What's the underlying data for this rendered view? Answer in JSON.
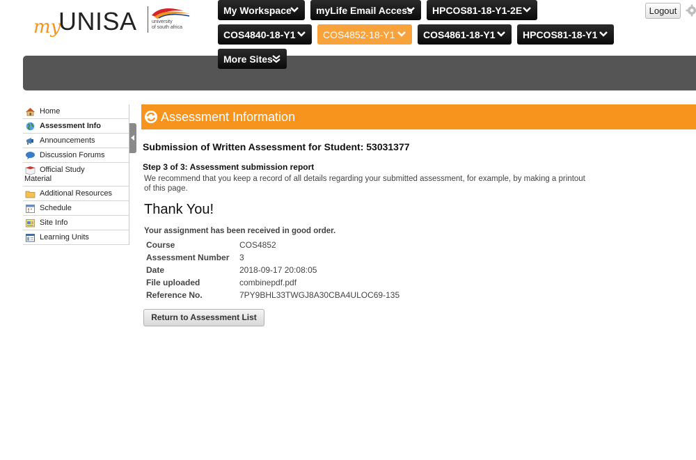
{
  "logo": {
    "my": "my",
    "unisa": "UNISA",
    "sub_line1": "university",
    "sub_line2": "of south africa"
  },
  "tabs": [
    {
      "label": "My Workspace",
      "active": false
    },
    {
      "label": "myLife Email Access",
      "active": false
    },
    {
      "label": "HPCOS81-18-Y1-2E",
      "active": false
    },
    {
      "label": "COS4840-18-Y1",
      "active": false
    },
    {
      "label": "COS4852-18-Y1",
      "active": true
    },
    {
      "label": "COS4861-18-Y1",
      "active": false
    },
    {
      "label": "HPCOS81-18-Y1",
      "active": false
    },
    {
      "label": "More Sites",
      "active": false
    }
  ],
  "header": {
    "logout_label": "Logout"
  },
  "colors": {
    "accent": "#f7941d",
    "active_tab": "#f7a23a",
    "tab_dark": "#151515",
    "topbar": "#555555"
  },
  "nav": {
    "items": [
      {
        "label": "Home",
        "icon": "home-icon"
      },
      {
        "label": "Assessment Info",
        "icon": "globe-icon",
        "current": true
      },
      {
        "label": "Announcements",
        "icon": "megaphone-icon"
      },
      {
        "label": "Discussion Forums",
        "icon": "speech-bubble-icon"
      },
      {
        "label_line1": "Official Study",
        "label_line2": "Material",
        "icon": "book-icon"
      },
      {
        "label": "Additional Resources",
        "icon": "folder-icon"
      },
      {
        "label": "Schedule",
        "icon": "calendar-icon"
      },
      {
        "label": "Site Info",
        "icon": "site-info-icon"
      },
      {
        "label": "Learning Units",
        "icon": "units-icon"
      }
    ]
  },
  "main": {
    "heading": "Assessment Information",
    "submission_title": "Submission of Written Assessment for Student: 53031377",
    "step": "Step 3 of 3: Assessment submission report",
    "recommend": "We recommend that you keep a record of all details regarding your submitted assessment, for example, by making a printout of this page.",
    "thanks": "Thank You!",
    "received": "Your assignment has been received in good order.",
    "details": [
      {
        "key": "Course",
        "value": "COS4852"
      },
      {
        "key": "Assessment Number",
        "value": "3"
      },
      {
        "key": "Date",
        "value": "2018-09-17 20:08:05"
      },
      {
        "key": "File uploaded",
        "value": "combinepdf.pdf"
      },
      {
        "key": "Reference No.",
        "value": "7PY9BHL33TWGJ8A30CBA4ULOC69-135"
      }
    ],
    "return_label": "Return to Assessment List"
  }
}
